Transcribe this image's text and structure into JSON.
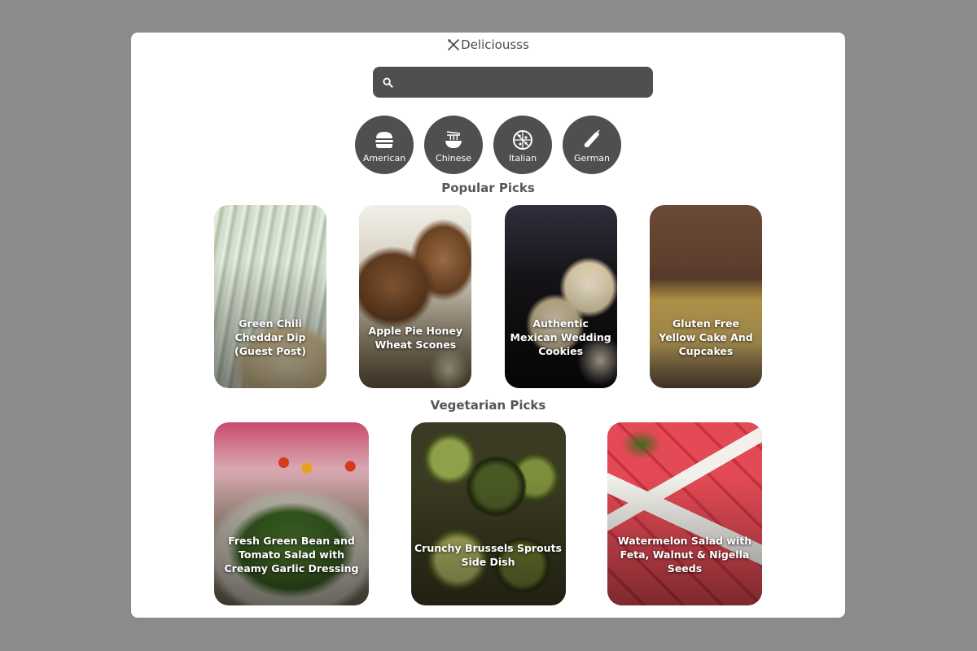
{
  "app": {
    "name": "Deliciousss",
    "logo_icon": "crossed-utensils-icon"
  },
  "search": {
    "placeholder": "",
    "value": "",
    "icon": "search-icon"
  },
  "categories": [
    {
      "label": "American",
      "icon": "burger-icon"
    },
    {
      "label": "Chinese",
      "icon": "noodles-icon"
    },
    {
      "label": "Italian",
      "icon": "pizza-icon"
    },
    {
      "label": "German",
      "icon": "sausage-icon"
    }
  ],
  "popular": {
    "title": "Popular Picks",
    "items": [
      {
        "title": "Green Chili Cheddar Dip (Guest Post)"
      },
      {
        "title": "Apple Pie Honey Wheat Scones"
      },
      {
        "title": "Authentic Mexican Wedding Cookies"
      },
      {
        "title": "Gluten Free Yellow Cake And Cupcakes"
      }
    ]
  },
  "vegetarian": {
    "title": "Vegetarian Picks",
    "items": [
      {
        "title": "Fresh Green Bean and Tomato Salad with Creamy Garlic Dressing"
      },
      {
        "title": "Crunchy Brussels Sprouts Side Dish"
      },
      {
        "title": "Watermelon Salad with Feta, Walnut & Nigella Seeds"
      }
    ]
  },
  "colors": {
    "background": "#8c8b89",
    "panel": "#ffffff",
    "accent": "#4f4f4f",
    "heading": "#565656"
  }
}
